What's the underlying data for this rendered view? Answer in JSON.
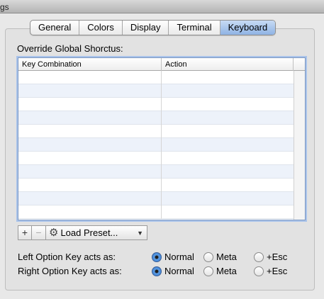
{
  "window": {
    "title_fragment": "gs"
  },
  "tabs": [
    {
      "label": "General",
      "selected": false
    },
    {
      "label": "Colors",
      "selected": false
    },
    {
      "label": "Display",
      "selected": false
    },
    {
      "label": "Terminal",
      "selected": false
    },
    {
      "label": "Keyboard",
      "selected": true
    }
  ],
  "shortcuts": {
    "section_label": "Override Global Shorctus:",
    "columns": [
      "Key Combination",
      "Action"
    ],
    "rows": []
  },
  "toolbar": {
    "add_label": "+",
    "remove_label": "−",
    "preset_icon": "gear-icon",
    "preset_label": "Load Preset...",
    "dropdown_icon": "triangle-down-icon"
  },
  "options": [
    {
      "label": "Left Option Key acts as:",
      "choices": [
        "Normal",
        "Meta",
        "+Esc"
      ],
      "selected": "Normal"
    },
    {
      "label": "Right Option Key acts as:",
      "choices": [
        "Normal",
        "Meta",
        "+Esc"
      ],
      "selected": "Normal"
    }
  ]
}
